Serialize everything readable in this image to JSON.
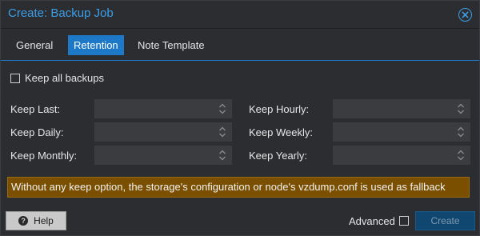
{
  "window": {
    "title": "Create: Backup Job",
    "accent": "#3d9ee8"
  },
  "tabs": [
    {
      "label": "General"
    },
    {
      "label": "Retention",
      "active": true
    },
    {
      "label": "Note Template"
    }
  ],
  "retention": {
    "keep_all_label": "Keep all backups",
    "keep_all_checked": false,
    "fields": {
      "keep_last": {
        "label": "Keep Last:",
        "value": ""
      },
      "keep_hourly": {
        "label": "Keep Hourly:",
        "value": ""
      },
      "keep_daily": {
        "label": "Keep Daily:",
        "value": ""
      },
      "keep_weekly": {
        "label": "Keep Weekly:",
        "value": ""
      },
      "keep_monthly": {
        "label": "Keep Monthly:",
        "value": ""
      },
      "keep_yearly": {
        "label": "Keep Yearly:",
        "value": ""
      }
    },
    "notice": "Without any keep option, the storage's configuration or node's vzdump.conf is used as fallback"
  },
  "footer": {
    "help_label": "Help",
    "advanced_label": "Advanced",
    "advanced_checked": false,
    "create_label": "Create"
  }
}
